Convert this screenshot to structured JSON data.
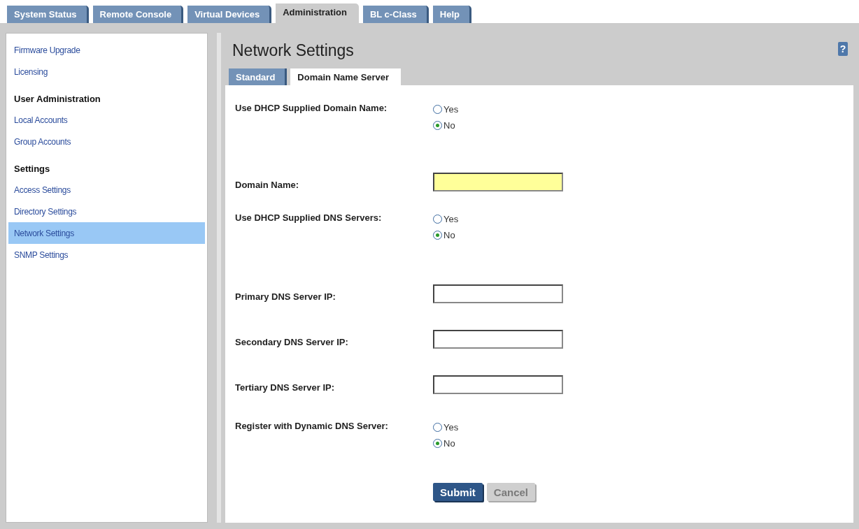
{
  "top_tabs": [
    {
      "label": "System Status",
      "selected": false
    },
    {
      "label": "Remote Console",
      "selected": false
    },
    {
      "label": "Virtual Devices",
      "selected": false
    },
    {
      "label": "Administration",
      "selected": true
    },
    {
      "label": "BL c-Class",
      "selected": false
    },
    {
      "label": "Help",
      "selected": false
    }
  ],
  "sidebar": {
    "items": [
      {
        "kind": "link",
        "label": "Firmware Upgrade",
        "selected": false
      },
      {
        "kind": "link",
        "label": "Licensing",
        "selected": false
      },
      {
        "kind": "heading",
        "label": "User Administration"
      },
      {
        "kind": "link",
        "label": "Local Accounts",
        "selected": false
      },
      {
        "kind": "link",
        "label": "Group Accounts",
        "selected": false
      },
      {
        "kind": "heading",
        "label": "Settings"
      },
      {
        "kind": "link",
        "label": "Access Settings",
        "selected": false
      },
      {
        "kind": "link",
        "label": "Directory Settings",
        "selected": false
      },
      {
        "kind": "link",
        "label": "Network Settings",
        "selected": true
      },
      {
        "kind": "link",
        "label": "SNMP Settings",
        "selected": false
      }
    ]
  },
  "page": {
    "title": "Network Settings",
    "help": "?",
    "tabs": [
      {
        "label": "Standard",
        "selected": false
      },
      {
        "label": "Domain Name Server",
        "selected": true
      }
    ],
    "fields": [
      {
        "kind": "radio",
        "label": "Use DHCP Supplied Domain Name:",
        "options": [
          {
            "label": "Yes",
            "selected": false
          },
          {
            "label": "No",
            "selected": true
          }
        ]
      },
      {
        "kind": "text",
        "label": "Domain Name:",
        "highlighted": true
      },
      {
        "kind": "radio",
        "label": "Use DHCP Supplied DNS Servers:",
        "options": [
          {
            "label": "Yes",
            "selected": false
          },
          {
            "label": "No",
            "selected": true
          }
        ]
      },
      {
        "kind": "text",
        "label": "Primary DNS Server IP:",
        "highlighted": false
      },
      {
        "kind": "text",
        "label": "Secondary DNS Server IP:",
        "highlighted": false
      },
      {
        "kind": "text",
        "label": "Tertiary DNS Server IP:",
        "highlighted": false
      },
      {
        "kind": "radio",
        "label": "Register with Dynamic DNS Server:",
        "options": [
          {
            "label": "Yes",
            "selected": false
          },
          {
            "label": "No",
            "selected": true
          }
        ]
      }
    ],
    "buttons": [
      {
        "label": "Submit",
        "disabled": false
      },
      {
        "label": "Cancel",
        "disabled": true
      }
    ]
  }
}
